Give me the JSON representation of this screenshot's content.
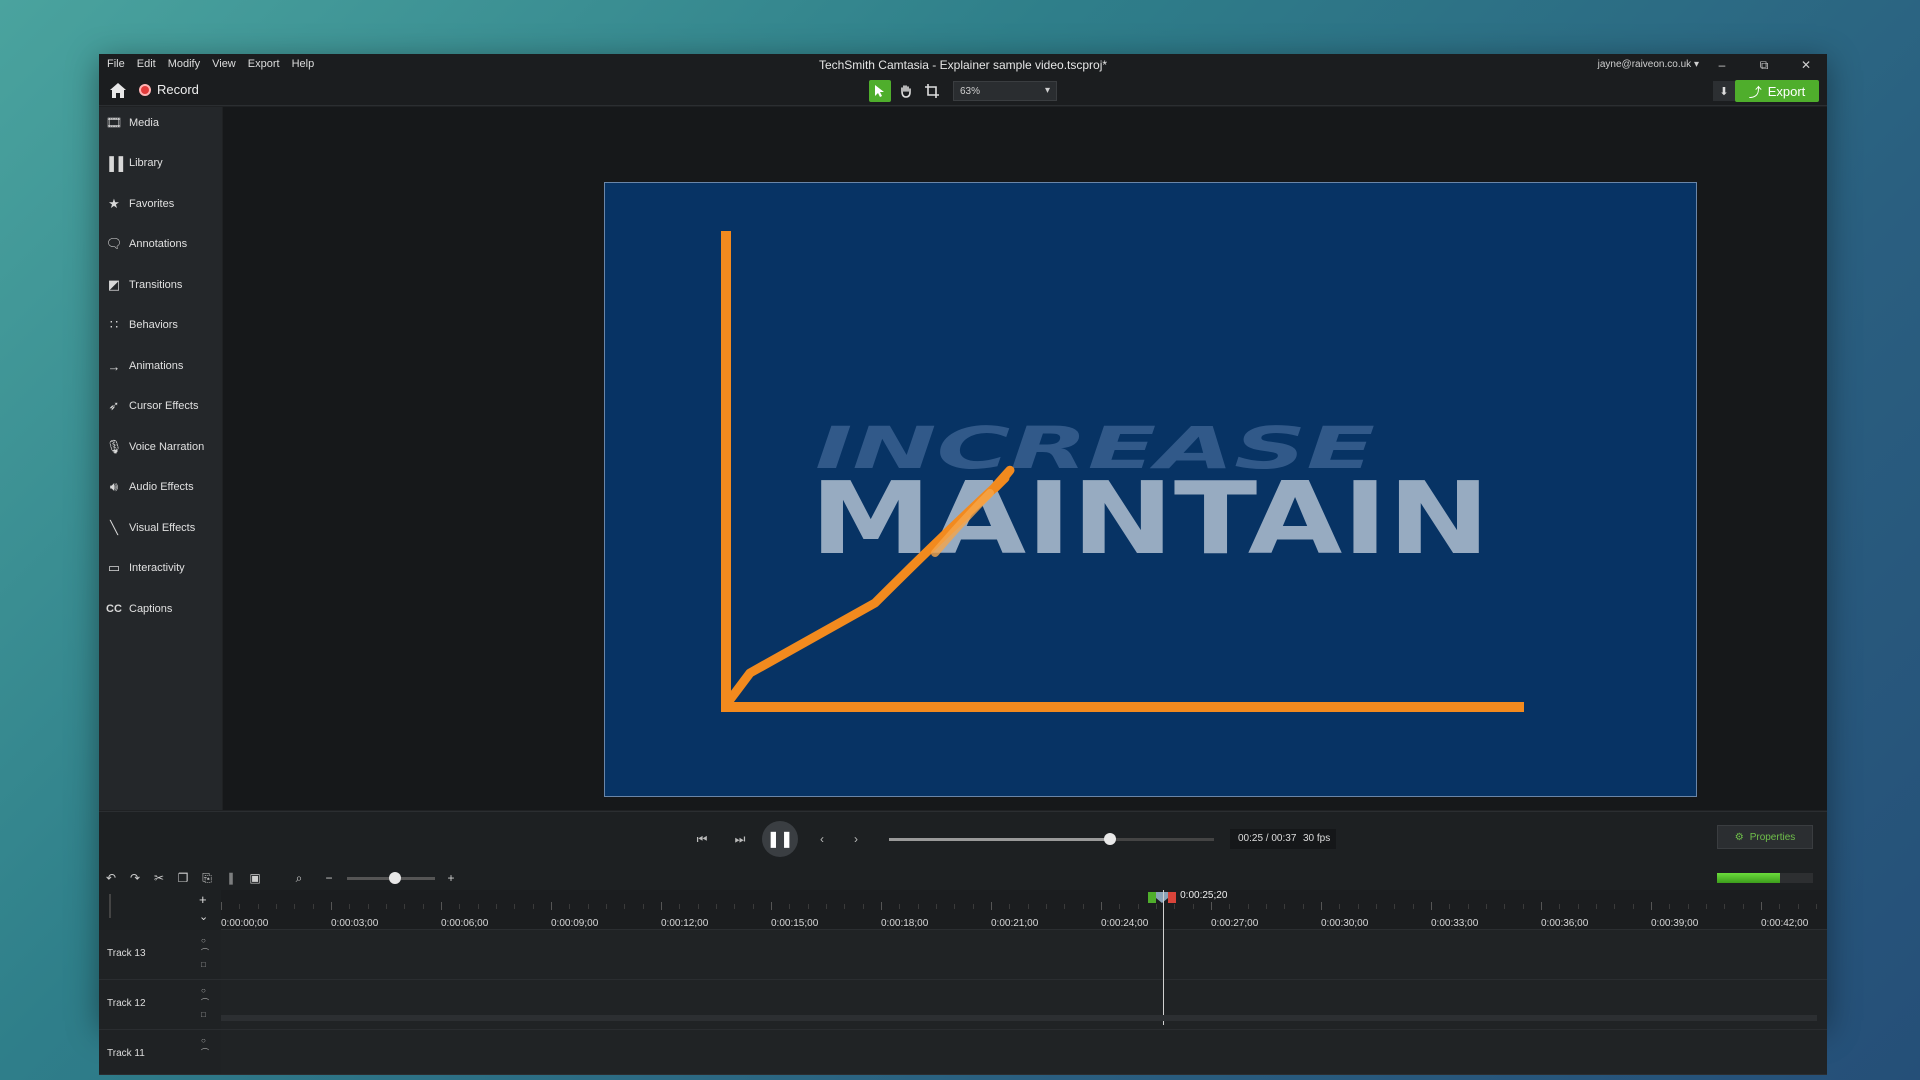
{
  "window": {
    "title": "TechSmith Camtasia - Explainer sample video.tscproj*",
    "user": "jayne@raiveon.co.uk",
    "controls": [
      "–",
      "⧉",
      "✕"
    ]
  },
  "menu": [
    "File",
    "Edit",
    "Modify",
    "View",
    "Export",
    "Help"
  ],
  "toolbar": {
    "record_label": "Record",
    "zoom_value": "63%",
    "export_label": "Export"
  },
  "sidebar": {
    "items": [
      {
        "label": "Media",
        "icon": "film-icon"
      },
      {
        "label": "Library",
        "icon": "library-icon"
      },
      {
        "label": "Favorites",
        "icon": "star-icon"
      },
      {
        "label": "Annotations",
        "icon": "annotation-icon"
      },
      {
        "label": "Transitions",
        "icon": "transition-icon"
      },
      {
        "label": "Behaviors",
        "icon": "behaviors-icon"
      },
      {
        "label": "Animations",
        "icon": "animation-icon"
      },
      {
        "label": "Cursor Effects",
        "icon": "cursor-icon"
      },
      {
        "label": "Voice Narration",
        "icon": "microphone-icon"
      },
      {
        "label": "Audio Effects",
        "icon": "speaker-icon"
      },
      {
        "label": "Visual Effects",
        "icon": "wand-icon"
      },
      {
        "label": "Interactivity",
        "icon": "interactivity-icon"
      },
      {
        "label": "Captions",
        "icon": "cc-icon"
      }
    ]
  },
  "canvas": {
    "text_top": "INCREASE",
    "text_main": "MAINTAIN",
    "bg_color": "#073364",
    "accent_color": "#f28a1e"
  },
  "playback": {
    "time": "00:25 / 00:37",
    "fps": "30 fps",
    "progress": 0.68,
    "properties_label": "Properties"
  },
  "timeline": {
    "zoom_level": 0.55,
    "audio_level": 0.66,
    "playhead_label": "0:00:25;20",
    "ticks": [
      "0:00:00;00",
      "0:00:03;00",
      "0:00:06;00",
      "0:00:09;00",
      "0:00:12;00",
      "0:00:15;00",
      "0:00:18;00",
      "0:00:21;00",
      "0:00:24;00",
      "0:00:27;00",
      "0:00:30;00",
      "0:00:33;00",
      "0:00:36;00",
      "0:00:39;00",
      "0:00:42;00"
    ],
    "tracks": [
      "Track 13",
      "Track 12",
      "Track 11"
    ]
  },
  "colors": {
    "accent_green": "#4fae2c",
    "record_red": "#e23b3b"
  }
}
